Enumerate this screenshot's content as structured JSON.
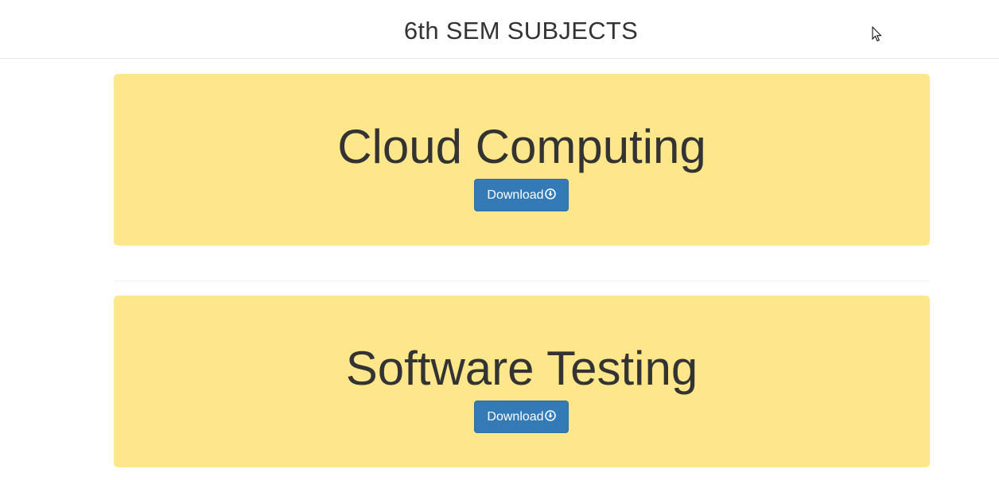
{
  "header": {
    "title": "6th SEM SUBJECTS"
  },
  "subjects": [
    {
      "title": "Cloud Computing",
      "button_label": "Download",
      "button_icon": "download-circle-icon"
    },
    {
      "title": "Software Testing",
      "button_label": "Download",
      "button_icon": "download-circle-icon"
    }
  ],
  "colors": {
    "card_background": "#fee78b",
    "button_background": "#337ab7",
    "text": "#333333"
  },
  "cursor": "arrow-cursor-icon"
}
